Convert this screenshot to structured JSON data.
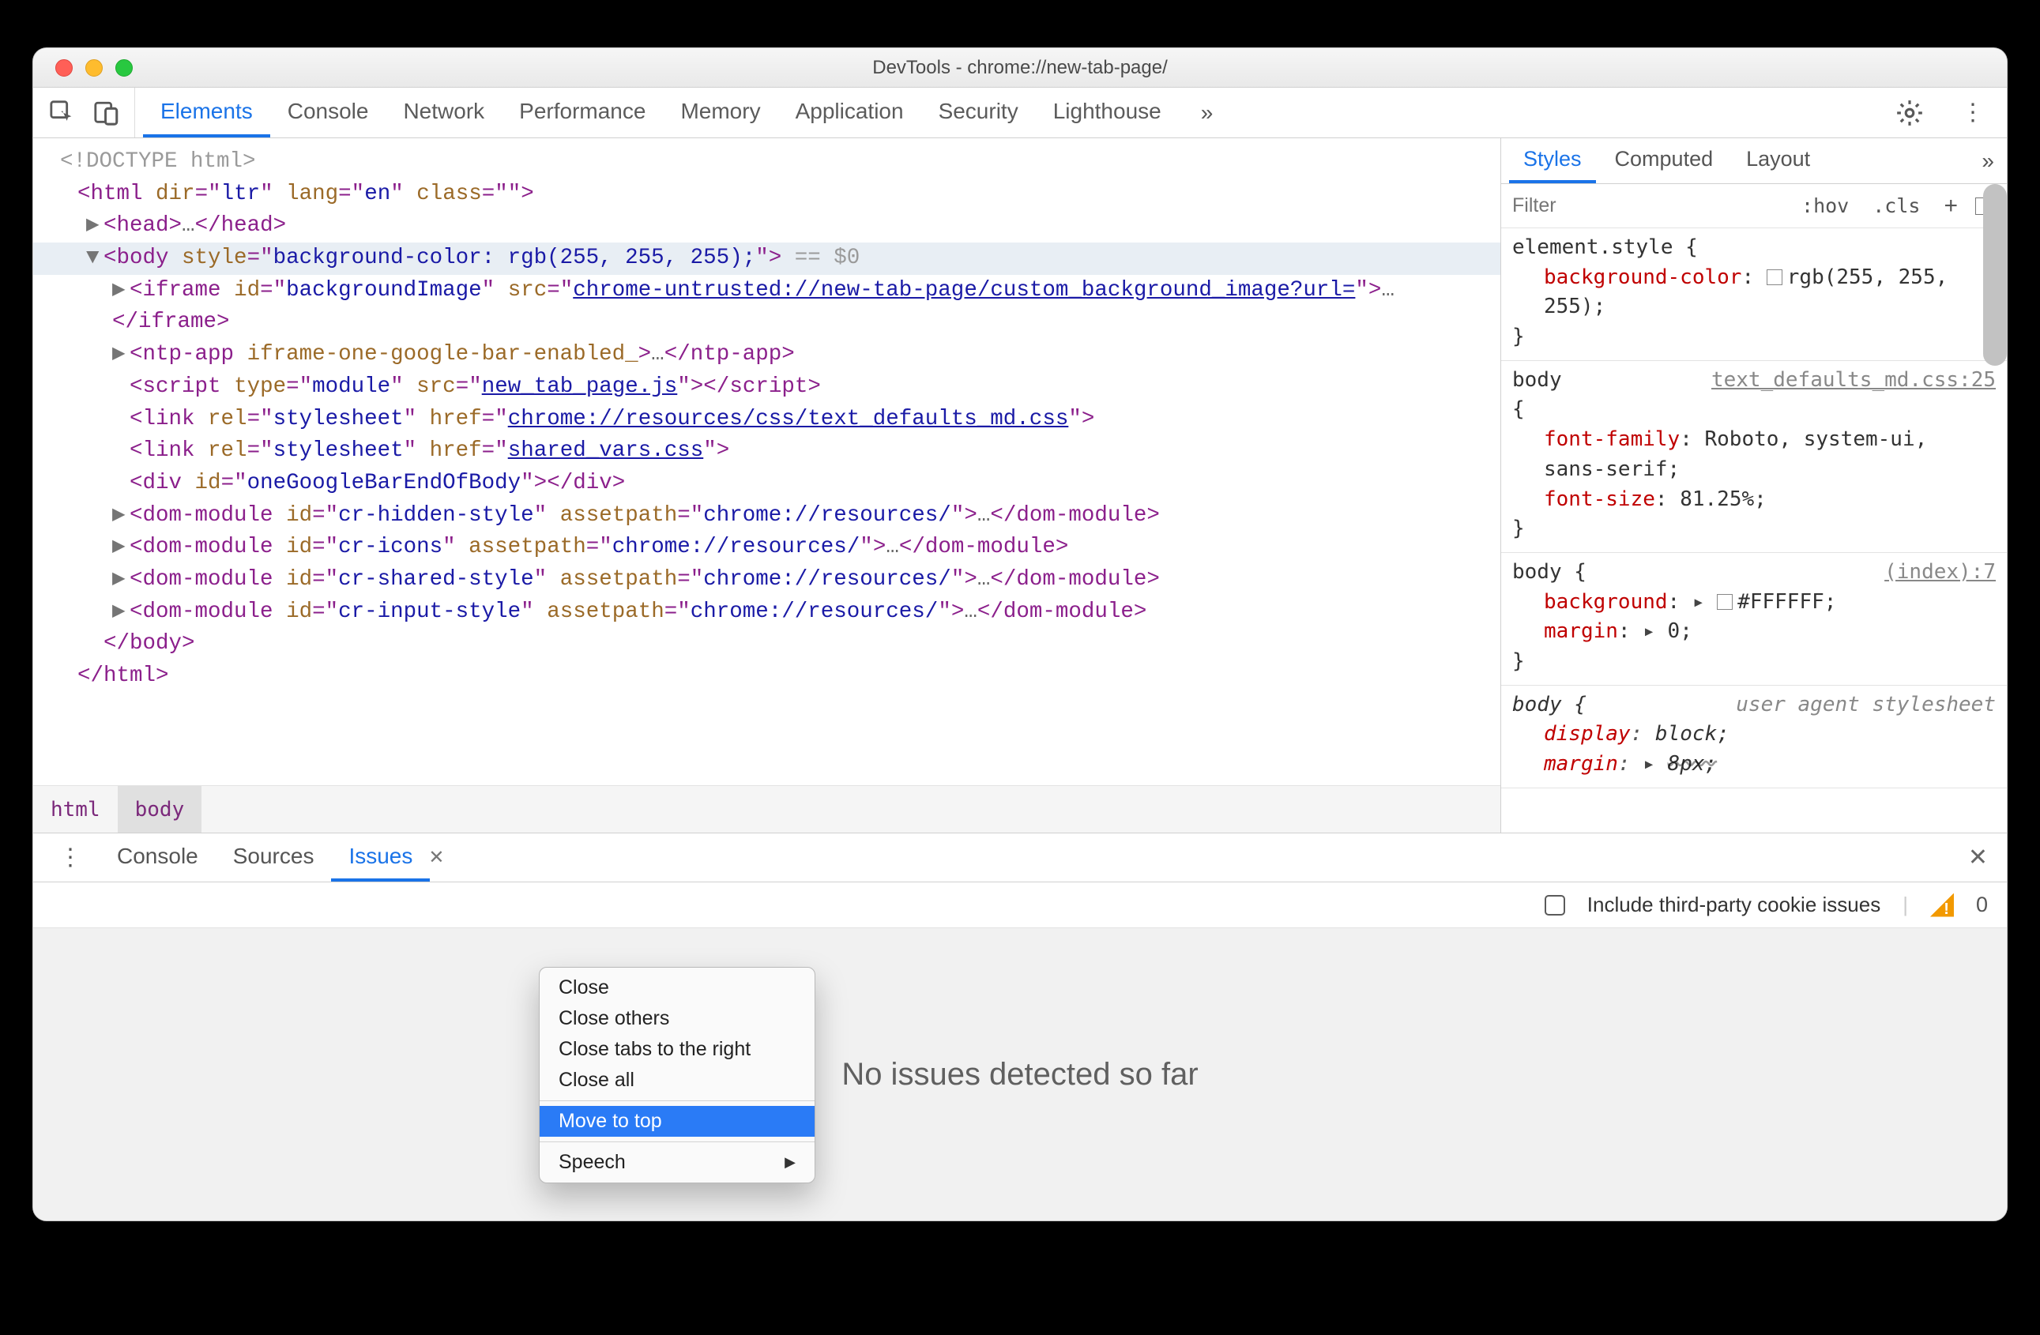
{
  "titlebar": {
    "title": "DevTools - chrome://new-tab-page/"
  },
  "topTabs": {
    "items": [
      "Elements",
      "Console",
      "Network",
      "Performance",
      "Memory",
      "Application",
      "Security",
      "Lighthouse"
    ],
    "active": "Elements"
  },
  "breadcrumb": {
    "items": [
      "html",
      "body"
    ],
    "active": "body"
  },
  "stylesPanel": {
    "tabs": [
      "Styles",
      "Computed",
      "Layout"
    ],
    "active": "Styles",
    "filterPlaceholder": "Filter",
    "hov": ":hov",
    "cls": ".cls",
    "rules": [
      {
        "selector": "element.style {",
        "src": "",
        "props": [
          {
            "name": "background-color",
            "swatch": "#ffffff",
            "value": "rgb(255, 255, 255);"
          }
        ],
        "close": "}"
      },
      {
        "selector": "body\n{",
        "src": "text_defaults_md.css:25",
        "props": [
          {
            "name": "font-family",
            "value": "Roboto, system-ui, sans-serif;"
          },
          {
            "name": "font-size",
            "value": "81.25%;"
          }
        ],
        "close": "}"
      },
      {
        "selector": "body {",
        "src": "(index):7",
        "props": [
          {
            "name": "background",
            "arrow": true,
            "swatch": "#FFFFFF",
            "value": "#FFFFFF;"
          },
          {
            "name": "margin",
            "arrow": true,
            "value": "0;"
          }
        ],
        "close": "}"
      },
      {
        "ua": true,
        "selector": "body {",
        "src": "user agent stylesheet",
        "props": [
          {
            "name": "display",
            "value": "block;"
          },
          {
            "name": "margin",
            "arrow": true,
            "value": "8px;",
            "strike": true
          }
        ],
        "close": ""
      }
    ]
  },
  "drawer": {
    "tabs": [
      "Console",
      "Sources",
      "Issues"
    ],
    "active": "Issues",
    "checkboxLabel": "Include third-party cookie issues",
    "issueCount": "0",
    "content": "No issues detected so far"
  },
  "contextMenu": {
    "items": [
      {
        "label": "Close"
      },
      {
        "label": "Close others"
      },
      {
        "label": "Close tabs to the right"
      },
      {
        "label": "Close all"
      },
      {
        "sep": true
      },
      {
        "label": "Move to top",
        "highlight": true
      },
      {
        "sep": true
      },
      {
        "label": "Speech",
        "submenu": true
      }
    ]
  },
  "domTree": {
    "gutter": "…",
    "selectedSuffix": " == $0",
    "lines": {
      "doctype": "<!DOCTYPE html>",
      "htmlOpen": {
        "tag": "html",
        "attrs": [
          [
            "dir",
            "ltr"
          ],
          [
            "lang",
            "en"
          ],
          [
            "class",
            ""
          ]
        ],
        "trailingClassBare": true
      },
      "head": {
        "arrow": true,
        "tag": "head",
        "ell": "…",
        "closeTag": "head"
      },
      "body": {
        "arrow": true,
        "open": true,
        "tag": "body",
        "attrs": [
          [
            "style",
            "background-color: rgb(255, 255, 255);"
          ]
        ]
      },
      "iframe": {
        "arrow": true,
        "tag": "iframe",
        "attrs": [
          [
            "id",
            "backgroundImage"
          ],
          [
            "src",
            "chrome-untrusted://new-tab-page/custom_background_image?url=",
            true
          ]
        ],
        "ell": "…",
        "closeTag": "iframe"
      },
      "ntp": {
        "arrow": true,
        "tag": "ntp-app",
        "bareAttr": "iframe-one-google-bar-enabled_",
        "ell": "…",
        "closeTag": "ntp-app"
      },
      "script": {
        "tag": "script",
        "attrs": [
          [
            "type",
            "module"
          ],
          [
            "src",
            "new_tab_page.js",
            true
          ]
        ],
        "closeTag": "script"
      },
      "link1": {
        "tag": "link",
        "attrs": [
          [
            "rel",
            "stylesheet"
          ],
          [
            "href",
            "chrome://resources/css/text_defaults_md.css",
            true
          ]
        ]
      },
      "link2": {
        "tag": "link",
        "attrs": [
          [
            "rel",
            "stylesheet"
          ],
          [
            "href",
            "shared_vars.css",
            true
          ]
        ]
      },
      "div": {
        "tag": "div",
        "attrs": [
          [
            "id",
            "oneGoogleBarEndOfBody"
          ]
        ],
        "closeTag": "div"
      },
      "dm1": {
        "arrow": true,
        "tag": "dom-module",
        "attrs": [
          [
            "id",
            "cr-hidden-style"
          ],
          [
            "assetpath",
            "chrome://resources/"
          ]
        ],
        "ell": "…",
        "closeTag": "dom-module"
      },
      "dm2": {
        "arrow": true,
        "tag": "dom-module",
        "attrs": [
          [
            "id",
            "cr-icons"
          ],
          [
            "assetpath",
            "chrome://resources/"
          ]
        ],
        "ell": "…",
        "closeTag": "dom-module"
      },
      "dm3": {
        "arrow": true,
        "tag": "dom-module",
        "attrs": [
          [
            "id",
            "cr-shared-style"
          ],
          [
            "assetpath",
            "chrome://resources/"
          ]
        ],
        "ell": "…",
        "closeTag": "dom-module"
      },
      "dm4": {
        "arrow": true,
        "tag": "dom-module",
        "attrs": [
          [
            "id",
            "cr-input-style"
          ],
          [
            "assetpath",
            "chrome://resources/"
          ]
        ],
        "ell": "…",
        "closeTag": "dom-module"
      },
      "bodyClose": "</body>",
      "htmlClose": "</html>"
    }
  }
}
